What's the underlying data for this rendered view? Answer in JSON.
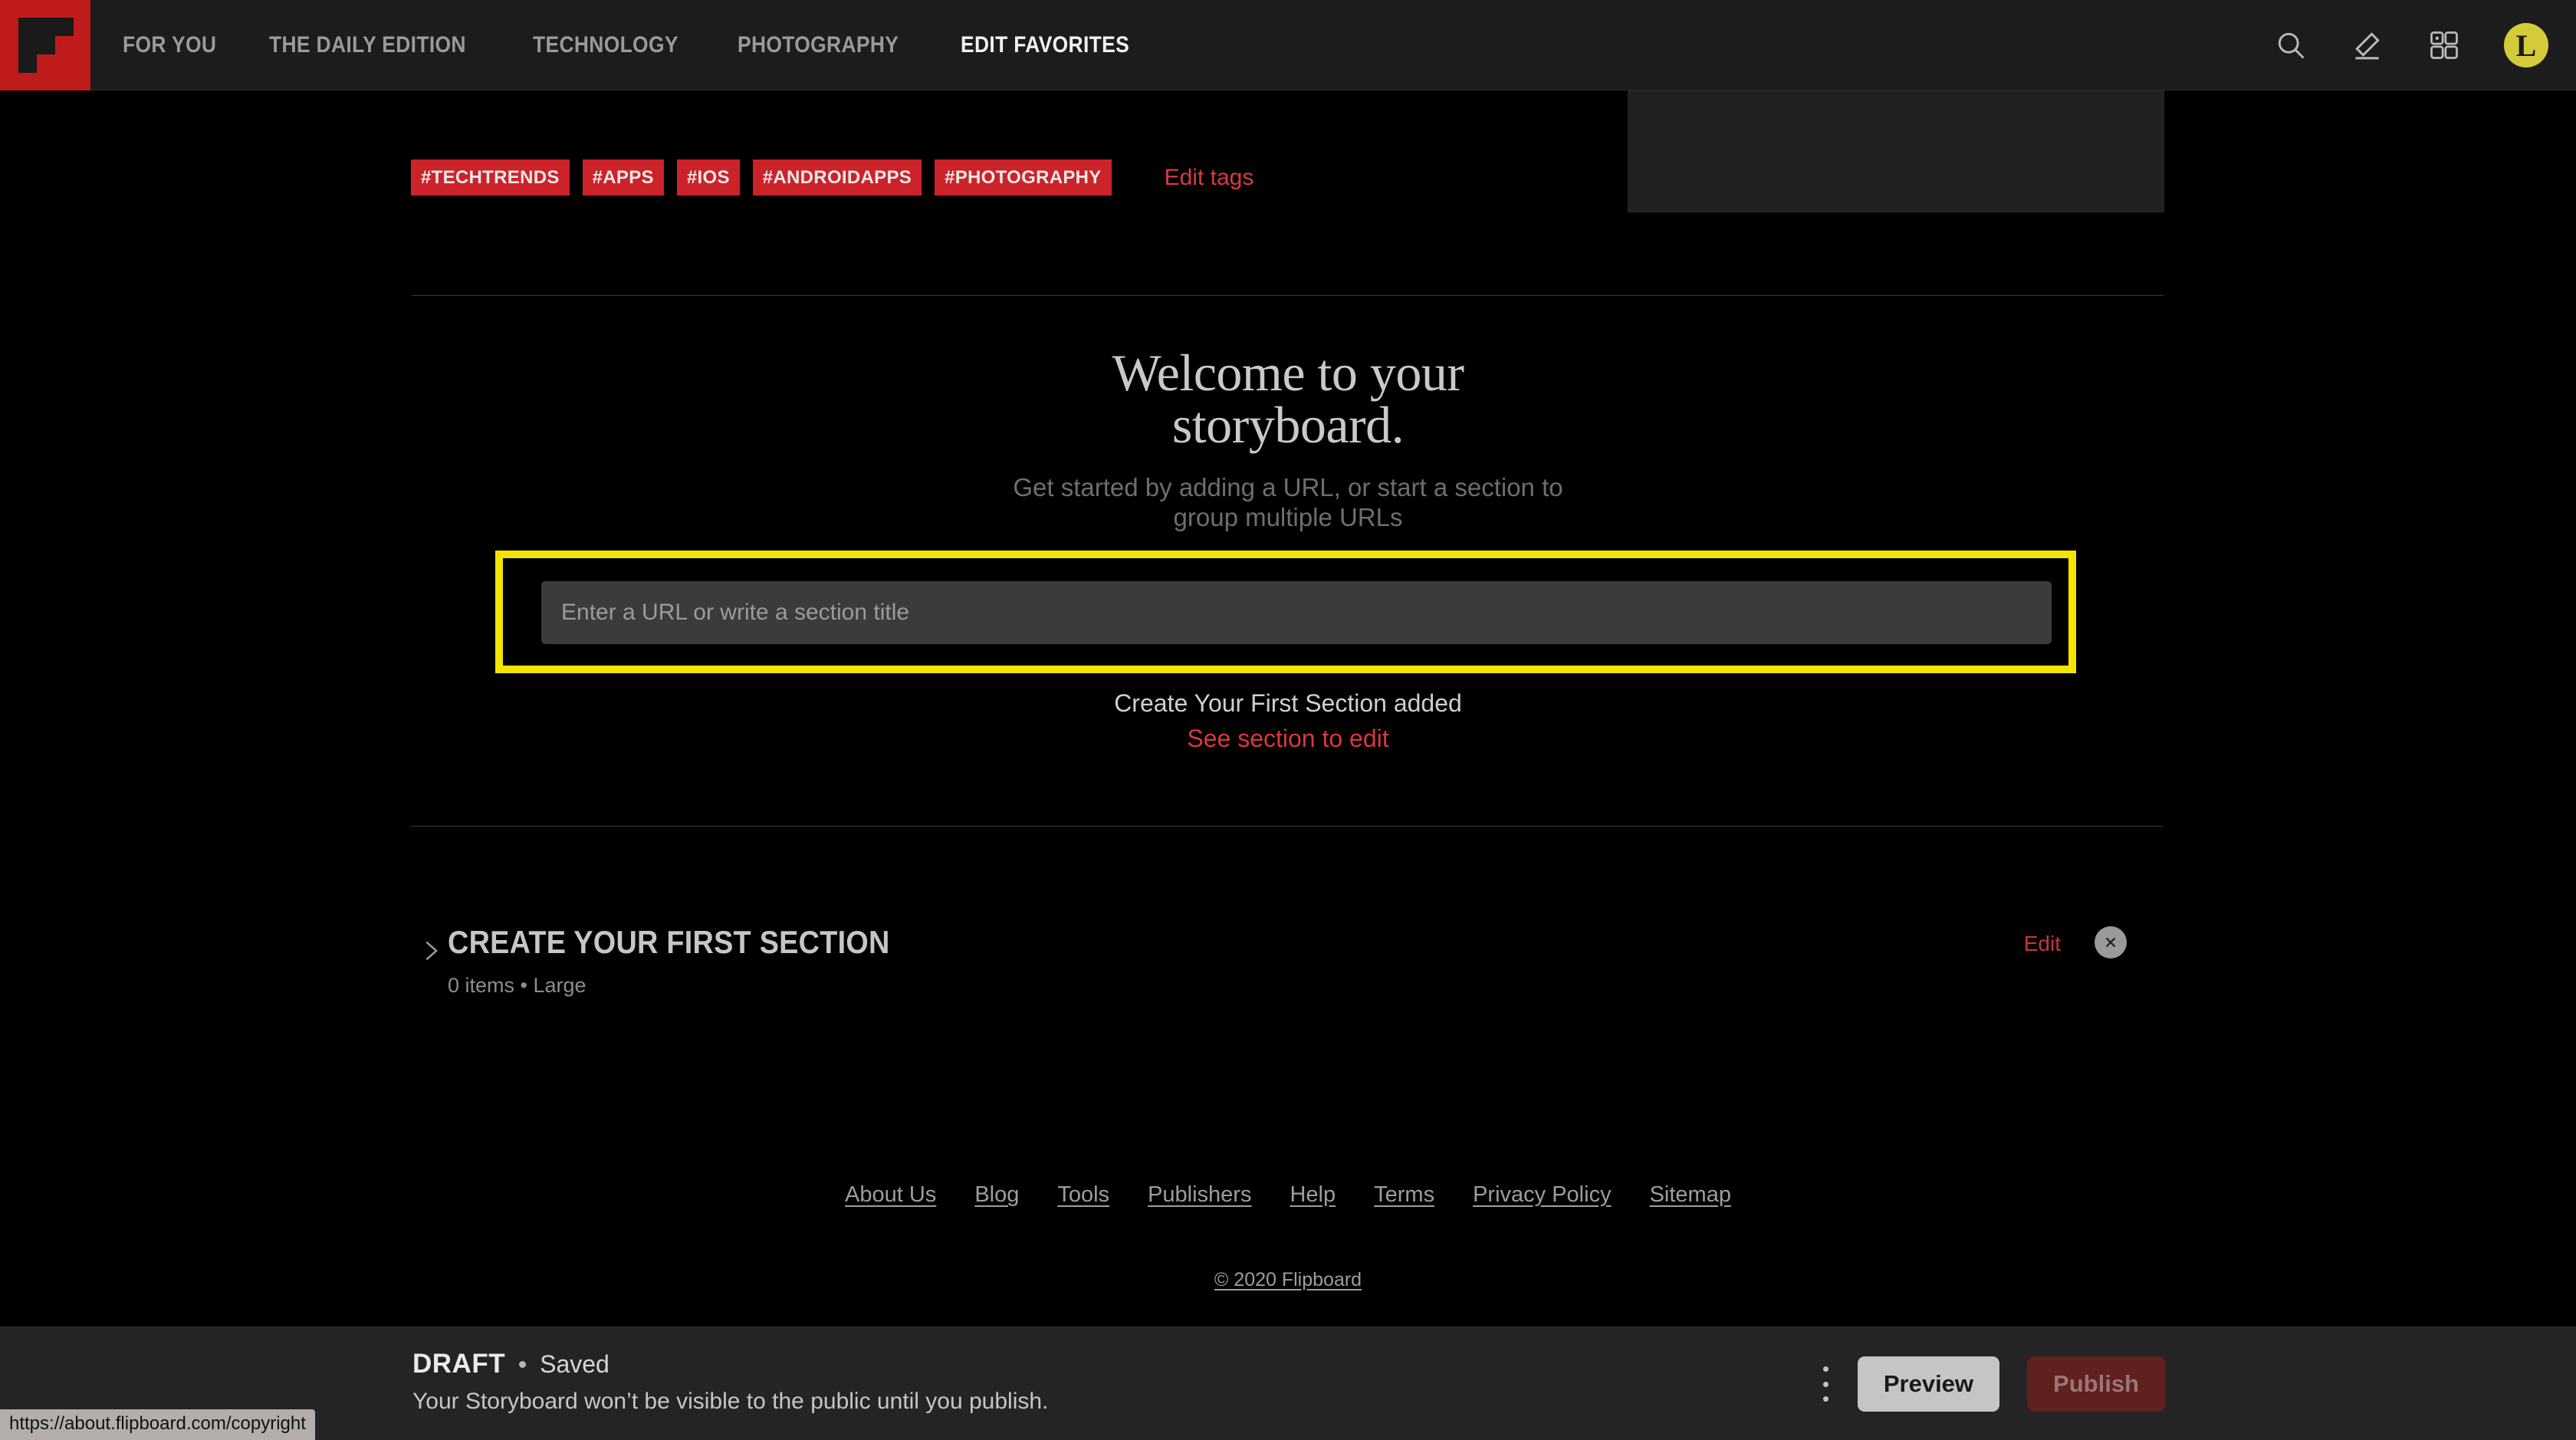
{
  "nav": {
    "logo_icon": "flipboard-logo-icon",
    "links": [
      {
        "label": "FOR YOU",
        "active": false
      },
      {
        "label": "THE DAILY EDITION",
        "active": false
      },
      {
        "label": "TECHNOLOGY",
        "active": false
      },
      {
        "label": "PHOTOGRAPHY",
        "active": false
      },
      {
        "label": "EDIT FAVORITES",
        "active": true
      }
    ],
    "icons": [
      "search-icon",
      "pencil-icon",
      "grid-icon"
    ],
    "avatar_initial": "L",
    "avatar_color": "#d4cb3a"
  },
  "tags": {
    "items": [
      "#TECHTRENDS",
      "#APPS",
      "#IOS",
      "#ANDROIDAPPS",
      "#PHOTOGRAPHY"
    ],
    "edit_label": "Edit tags",
    "tag_color": "#cc2229",
    "edit_color": "#d83a3f"
  },
  "welcome": {
    "title_line1": "Welcome to your",
    "title_line2": "storyboard.",
    "subtitle_line1": "Get started by adding a URL, or start a section to",
    "subtitle_line2": "group multiple URLs"
  },
  "url_field": {
    "placeholder": "Enter a URL or write a section title",
    "value": "",
    "highlight_color": "#f5e400"
  },
  "added_notice": {
    "message": "Create Your First Section added",
    "link": "See section to edit"
  },
  "section": {
    "title": "CREATE YOUR FIRST SECTION",
    "meta": "0 items • Large",
    "edit_label": "Edit",
    "close_icon": "close-icon",
    "chevron_icon": "chevron-right-icon"
  },
  "footer": {
    "links": [
      "About Us",
      "Blog",
      "Tools",
      "Publishers",
      "Help",
      "Terms",
      "Privacy Policy",
      "Sitemap"
    ],
    "copyright": "© 2020 Flipboard"
  },
  "draft_bar": {
    "label": "DRAFT",
    "saved": "Saved",
    "note": "Your Storyboard won’t be visible to the public until you publish.",
    "menu_icon": "kebab-menu-icon",
    "preview_label": "Preview",
    "publish_label": "Publish"
  },
  "status_bar": {
    "url": "https://about.flipboard.com/copyright"
  }
}
